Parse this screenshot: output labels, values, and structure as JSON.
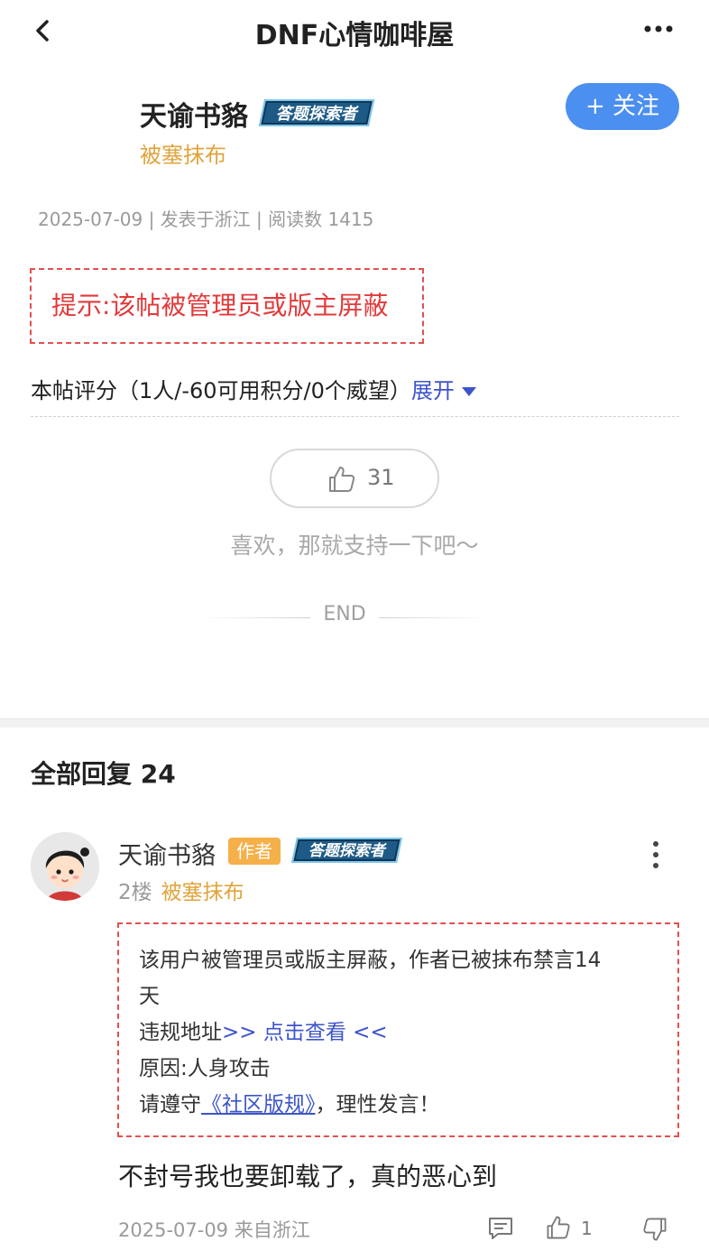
{
  "nav": {
    "title": "DNF心情咖啡屋"
  },
  "post": {
    "author": "天谕书貉",
    "explorer_badge": "答题探索者",
    "status_tag": "被塞抹布",
    "follow_label": "+ 关注",
    "meta": "2025-07-09 | 发表于浙江 | 阅读数 1415",
    "notice": "提示:该帖被管理员或版主屏蔽",
    "rating_text": "本帖评分（1人/-60可用积分/0个威望）",
    "rating_expand": "展开",
    "like_count": "31",
    "support_text": "喜欢，那就支持一下吧～",
    "end_text": "END"
  },
  "replies": {
    "title": "全部回复  24",
    "items": [
      {
        "name": "天谕书貉",
        "author_tag": "作者",
        "explorer_badge": "答题探索者",
        "floor": "2楼",
        "status_tag": "被塞抹布",
        "notice_line1": "该用户被管理员或版主屏蔽，作者已被抹布禁言14",
        "notice_line1b": "天",
        "notice_line2_prefix": "违规地址",
        "notice_line2_link": ">> 点击查看 <<",
        "notice_line3": "原因:人身攻击",
        "notice_line4_prefix": "请遵守",
        "notice_line4_link": "《社区版规》",
        "notice_line4_suffix": "，理性发言！",
        "content": "不封号我也要卸载了，真的恶心到",
        "meta": "2025-07-09 来自浙江",
        "like_count": "1"
      }
    ]
  },
  "colors": {
    "accent_blue": "#4b8ff0",
    "link_blue": "#3d55c8",
    "warning_red": "#e23a3a",
    "tag_orange": "#e0a43c",
    "author_tag_bg": "#f5b04a"
  },
  "icons": {
    "back": "back-chevron-icon",
    "more": "more-horizontal-icon",
    "like": "thumbs-up-icon",
    "comment": "comment-icon",
    "dislike": "thumbs-down-icon",
    "caret": "caret-down-icon"
  }
}
